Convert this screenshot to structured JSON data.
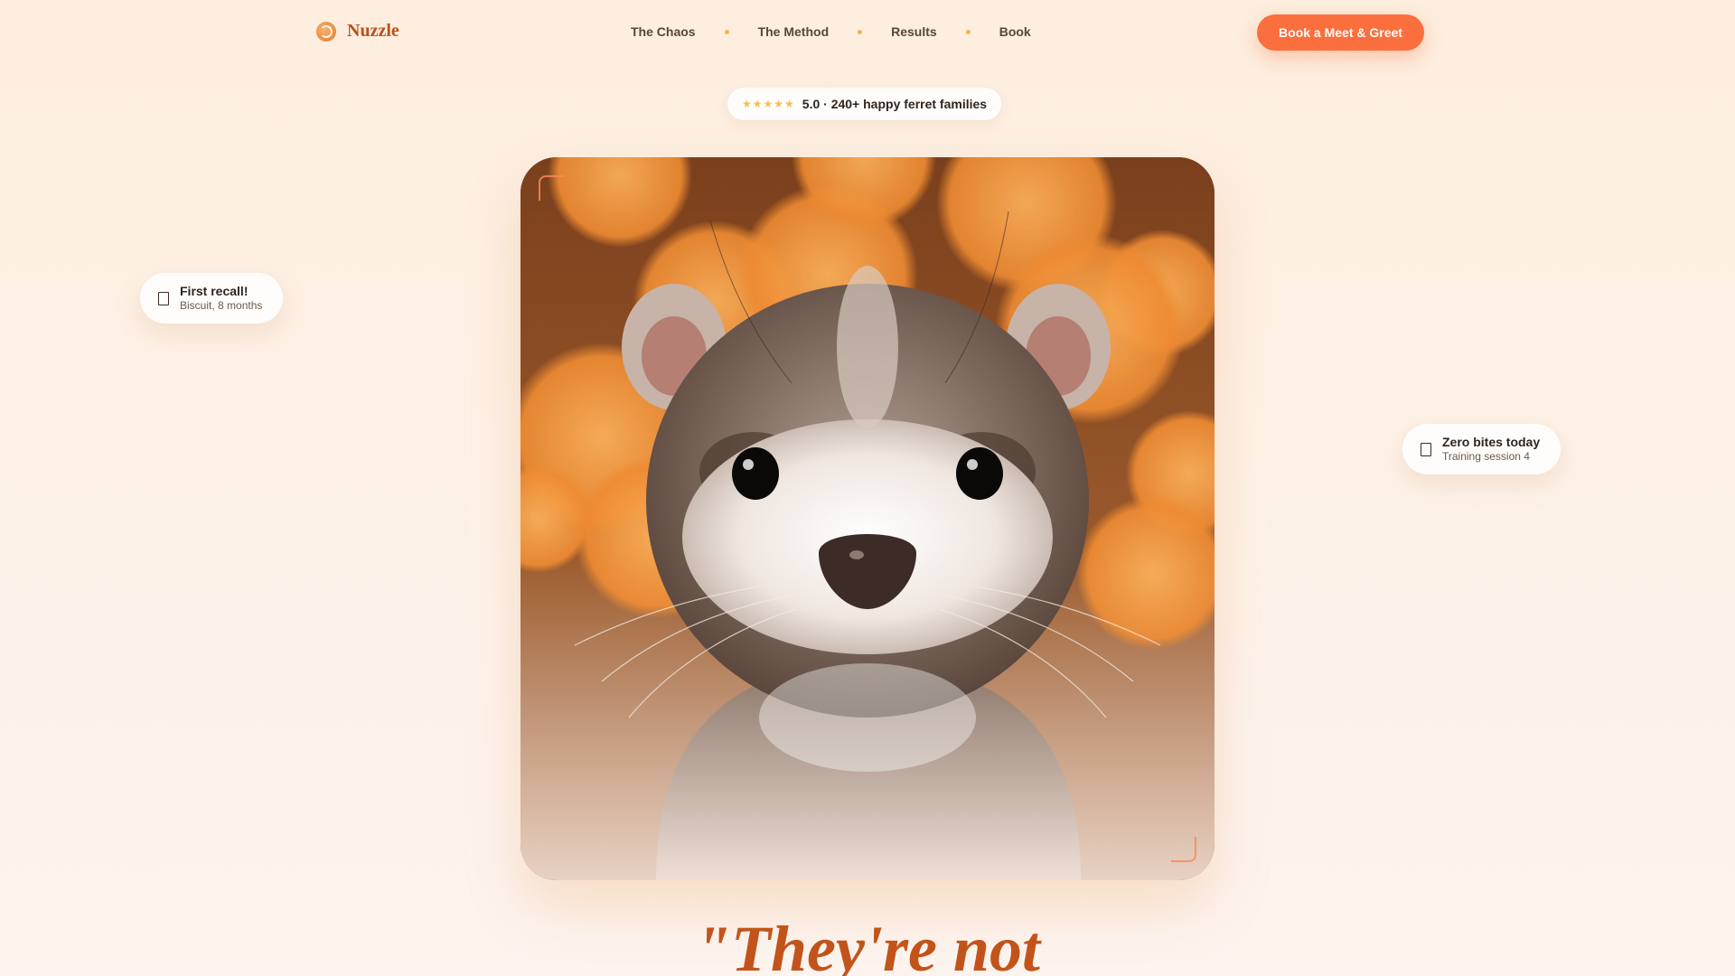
{
  "brand": {
    "name": "Nuzzle",
    "icon": "spiral-logo-icon"
  },
  "nav": {
    "links": [
      "The Chaos",
      "The Method",
      "Results",
      "Book"
    ],
    "cta_label": "Book a Meet & Greet"
  },
  "rating": {
    "stars": "★★★★★",
    "text": "5.0 · 240+ happy ferret families"
  },
  "hero": {
    "image": "ferret-portrait-photo"
  },
  "cards": {
    "left": {
      "icon": "note-icon",
      "title": "First recall!",
      "subtitle": "Biscuit, 8 months"
    },
    "right": {
      "icon": "note-icon",
      "title": "Zero bites today",
      "subtitle": "Training session 4"
    }
  },
  "headline": "\"They're not",
  "colors": {
    "accent": "#fb6e3d",
    "brand": "#b8521a",
    "headline": "#c2541b",
    "star": "#f3c24a"
  }
}
